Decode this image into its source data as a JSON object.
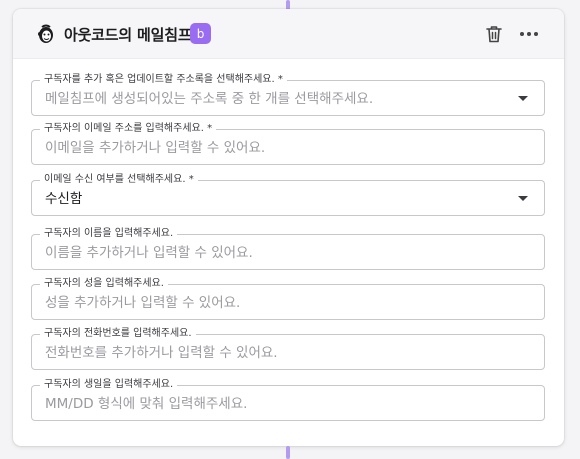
{
  "header": {
    "title": "아웃코드의 메일침프",
    "badge": "b",
    "app_icon": "mailchimp-icon",
    "delete_icon": "trash-icon",
    "more_icon": "more-horizontal-icon"
  },
  "fields": [
    {
      "label": "구독자를 추가 혹은 업데이트할 주소록을 선택해주세요. *",
      "value": "",
      "placeholder": "메일침프에 생성되어있는 주소록 중 한 개를 선택해주세요.",
      "type": "select"
    },
    {
      "label": "구독자의 이메일 주소를 입력해주세요. *",
      "value": "",
      "placeholder": "이메일을 추가하거나 입력할 수 있어요.",
      "type": "input"
    },
    {
      "label": "이메일 수신 여부를 선택해주세요. *",
      "value": "수신함",
      "placeholder": "",
      "type": "select"
    },
    {
      "label": "구독자의 이름을 입력해주세요.",
      "value": "",
      "placeholder": "이름을 추가하거나 입력할 수 있어요.",
      "type": "input"
    },
    {
      "label": "구독자의 성을 입력해주세요.",
      "value": "",
      "placeholder": "성을 추가하거나 입력할 수 있어요.",
      "type": "input"
    },
    {
      "label": "구독자의 전화번호를 입력해주세요.",
      "value": "",
      "placeholder": "전화번호를 추가하거나 입력할 수 있어요.",
      "type": "input"
    },
    {
      "label": "구독자의 생일을 입력해주세요.",
      "value": "",
      "placeholder": "MM/DD 형식에 맞춰 입력해주세요.",
      "type": "input"
    }
  ],
  "colors": {
    "accent": "#9a6cf2",
    "connector": "#b39cf0"
  }
}
